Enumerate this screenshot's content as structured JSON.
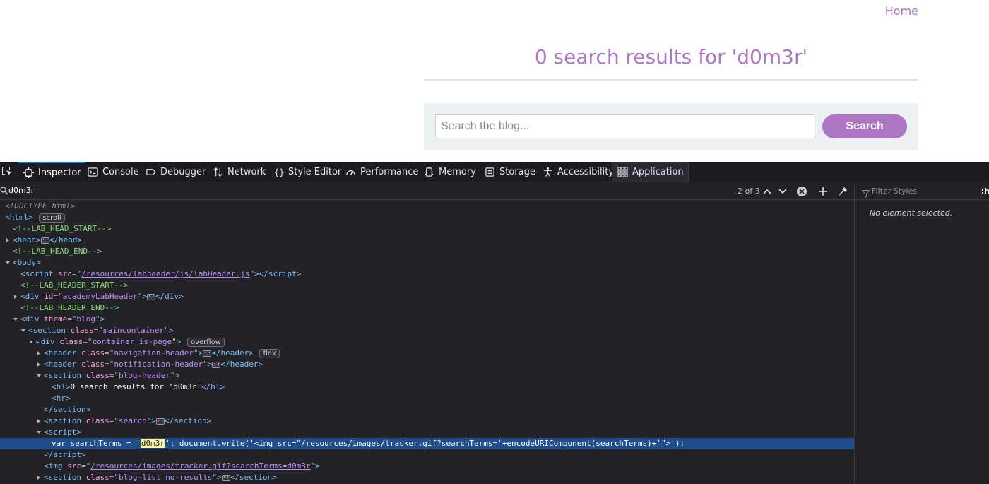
{
  "page": {
    "home_link": "Home",
    "title": "0 search results for 'd0m3r'",
    "search": {
      "placeholder": "Search the blog...",
      "value": "",
      "button_label": "Search"
    }
  },
  "devtools": {
    "tabs": [
      "Inspector",
      "Console",
      "Debugger",
      "Network",
      "Style Editor",
      "Performance",
      "Memory",
      "Storage",
      "Accessibility",
      "Application"
    ],
    "selected_tab": "Inspector",
    "search_query": "d0m3r",
    "match_count": "2 of 3",
    "rules": {
      "filter_placeholder": "Filter Styles",
      "extra": ":h",
      "empty_message": "No element selected."
    },
    "badges": {
      "scroll": "scroll",
      "overflow": "overflow",
      "flex": "flex"
    },
    "markup": {
      "doctype": "<!DOCTYPE html>",
      "c_lab_head_start": "<!--LAB_HEAD_START-->",
      "c_lab_head_end": "<!--LAB_HEAD_END-->",
      "c_lab_header_start": "<!--LAB_HEADER_START-->",
      "c_lab_header_end": "<!--LAB_HEADER_END-->",
      "labheader_src": "/resources/labheader/js/labHeader.js",
      "academy_id": "academyLabHeader",
      "theme": "blog",
      "maincontainer": "maincontainer",
      "container_class": "container is-page",
      "nav_header": "navigation-header",
      "notif_header": "notification-header",
      "blog_header": "blog-header",
      "h1_text": "0 search results for 'd0m3r'",
      "search_class": "search",
      "script_prefix": "var searchTerms = '",
      "script_term": "d0m3r",
      "script_suffix": "'; document.write('<img src=\"/resources/images/tracker.gif?searchTerms='+encodeURIComponent(searchTerms)+'\">');",
      "img_src": "/resources/images/tracker.gif?searchTerms=d0m3r",
      "blog_list": "blog-list no-results"
    }
  }
}
